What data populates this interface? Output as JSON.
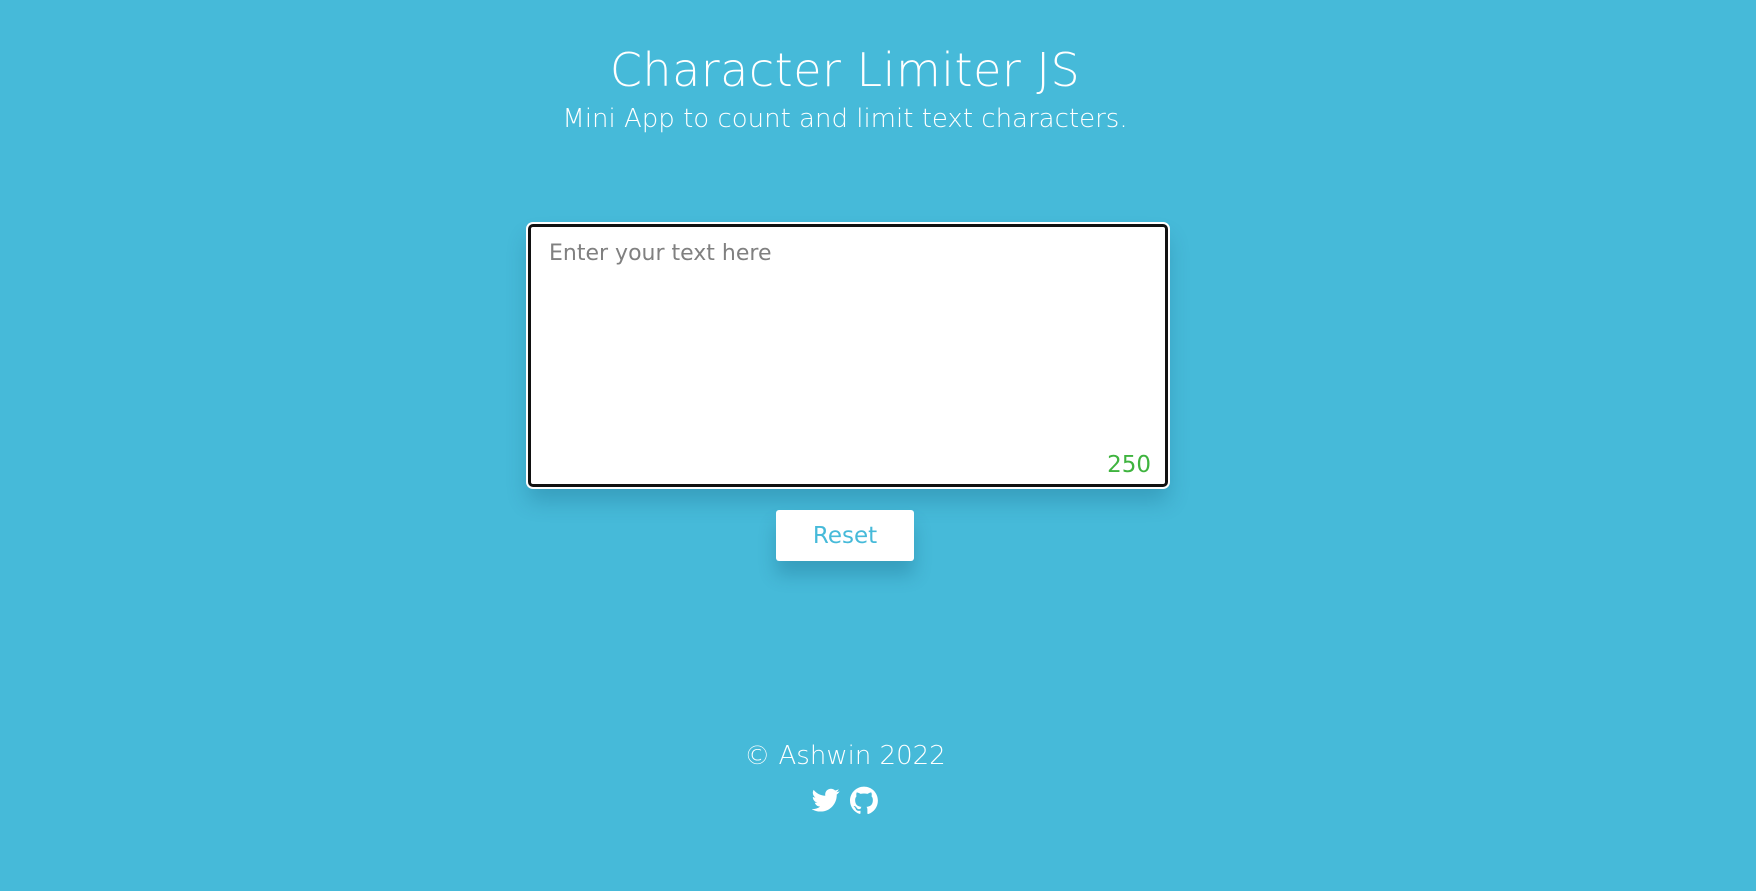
{
  "header": {
    "title": "Character Limiter JS",
    "subtitle": "Mini App to count and limit text characters."
  },
  "editor": {
    "placeholder": "Enter your text here",
    "value": "",
    "remaining_count": "250",
    "count_color": "#3fb43f"
  },
  "actions": {
    "reset_label": "Reset"
  },
  "footer": {
    "copyright": "© Ashwin 2022",
    "links": [
      {
        "icon": "twitter-icon"
      },
      {
        "icon": "github-icon"
      }
    ]
  },
  "colors": {
    "background": "#46bad9",
    "text": "#ffffff",
    "accent": "#46bad9"
  }
}
